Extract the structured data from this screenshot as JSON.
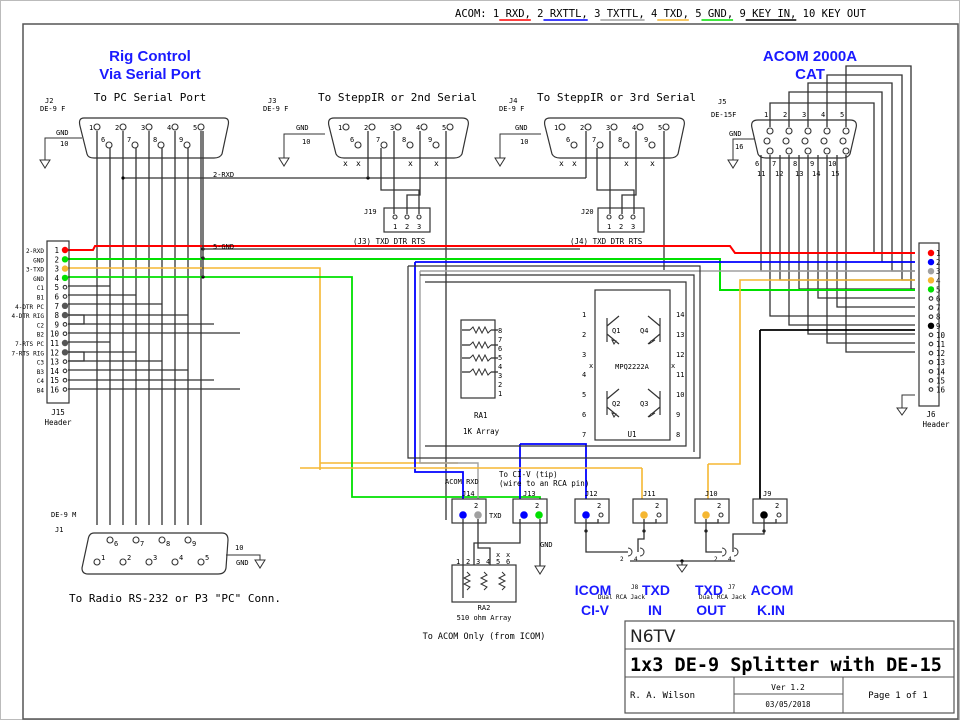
{
  "legend": {
    "prefix": "ACOM:",
    "items": [
      {
        "label": "1 RXD",
        "color": "#ff0000"
      },
      {
        "label": "2 RXTTL",
        "color": "#0000ff"
      },
      {
        "label": "3 TXTTL",
        "color": "#a0a0a0"
      },
      {
        "label": "4 TXD",
        "color": "#f5b732"
      },
      {
        "label": "5 GND",
        "color": "#00e000"
      },
      {
        "label": "9 KEY IN",
        "color": "#000000"
      },
      {
        "label": "10 KEY OUT",
        "color": null
      }
    ]
  },
  "headings": {
    "rig_control_1": "Rig Control",
    "rig_control_2": "Via Serial Port",
    "acom_1": "ACOM 2000A",
    "acom_2": "CAT"
  },
  "connectors": {
    "j2": {
      "ref": "J2",
      "type": "DE-9 F",
      "title": "To PC Serial Port",
      "gnd": "GND",
      "gnd_pin": "10"
    },
    "j3": {
      "ref": "J3",
      "type": "DE-9 F",
      "title": "To SteppIR or 2nd Serial",
      "gnd": "GND",
      "gnd_pin": "10"
    },
    "j4": {
      "ref": "J4",
      "type": "DE-9 F",
      "title": "To SteppIR or 3rd Serial",
      "gnd": "GND",
      "gnd_pin": "10"
    },
    "j5": {
      "ref": "J5",
      "type": "DE-15F",
      "gnd": "GND",
      "gnd_pin": "16",
      "top_pins": [
        "1",
        "2",
        "3",
        "4",
        "5"
      ],
      "bottom_pins": [
        "6",
        "7",
        "8",
        "9",
        "10"
      ],
      "bottom2_pins": [
        "11",
        "12",
        "13",
        "14",
        "15"
      ]
    },
    "j1": {
      "ref": "J1",
      "type": "DE-9 M",
      "title": "To Radio RS-232 or P3 \"PC\" Conn.",
      "gnd": "GND",
      "gnd_pin": "10"
    },
    "de9_top": [
      "1",
      "2",
      "3",
      "4",
      "5"
    ],
    "de9_bottom": [
      "6",
      "7",
      "8",
      "9"
    ]
  },
  "nets": {
    "rxd": "2-RXD",
    "gnd": "5-GND"
  },
  "j19": {
    "ref": "J19",
    "pins": [
      "1",
      "2",
      "3"
    ],
    "caption": "(J3) TXD DTR RTS"
  },
  "j20": {
    "ref": "J20",
    "pins": [
      "1",
      "2",
      "3"
    ],
    "caption": "(J4) TXD DTR RTS"
  },
  "j15": {
    "ref": "J15",
    "sub": "Header",
    "pins": [
      {
        "n": "1",
        "label": "2-RXD",
        "color": "#ff0000"
      },
      {
        "n": "2",
        "label": "GND",
        "color": "#00e000"
      },
      {
        "n": "3",
        "label": "3-TXD",
        "color": "#f5b732"
      },
      {
        "n": "4",
        "label": "GND",
        "color": "#00e000"
      },
      {
        "n": "5",
        "label": "C1",
        "color": null
      },
      {
        "n": "6",
        "label": "B1",
        "color": null
      },
      {
        "n": "7",
        "label": "4-DTR PC",
        "color": "#555555"
      },
      {
        "n": "8",
        "label": "4-DTR RIG",
        "color": "#555555"
      },
      {
        "n": "9",
        "label": "C2",
        "color": null
      },
      {
        "n": "10",
        "label": "B2",
        "color": null
      },
      {
        "n": "11",
        "label": "7-RTS PC",
        "color": "#555555"
      },
      {
        "n": "12",
        "label": "7-RTS RIG",
        "color": "#555555"
      },
      {
        "n": "13",
        "label": "C3",
        "color": null
      },
      {
        "n": "14",
        "label": "B3",
        "color": null
      },
      {
        "n": "15",
        "label": "C4",
        "color": null
      },
      {
        "n": "16",
        "label": "B4",
        "color": null
      }
    ]
  },
  "j6": {
    "ref": "J6",
    "sub": "Header",
    "pins": [
      {
        "n": "1",
        "color": "#ff0000"
      },
      {
        "n": "2",
        "color": "#0000ff"
      },
      {
        "n": "3",
        "color": "#a0a0a0"
      },
      {
        "n": "4",
        "color": "#f5b732"
      },
      {
        "n": "5",
        "color": "#00e000"
      },
      {
        "n": "6",
        "color": null
      },
      {
        "n": "7",
        "color": null
      },
      {
        "n": "8",
        "color": null
      },
      {
        "n": "9",
        "color": "#000000"
      },
      {
        "n": "10",
        "color": null
      },
      {
        "n": "11",
        "color": null
      },
      {
        "n": "12",
        "color": null
      },
      {
        "n": "13",
        "color": null
      },
      {
        "n": "14",
        "color": null
      },
      {
        "n": "15",
        "color": null
      },
      {
        "n": "16",
        "color": null
      }
    ]
  },
  "ra1": {
    "ref": "RA1",
    "desc": "1K Array",
    "pins": [
      "8",
      "7",
      "6",
      "5",
      "4",
      "3",
      "2",
      "1"
    ]
  },
  "u1": {
    "ref": "U1",
    "part": "MPQ2222A",
    "transistors": [
      "Q1",
      "Q4",
      "Q2",
      "Q3"
    ],
    "left_pins": [
      "1",
      "2",
      "3",
      "4",
      "5",
      "6",
      "7"
    ],
    "right_pins": [
      "14",
      "13",
      "12",
      "11",
      "10",
      "9",
      "8"
    ]
  },
  "small_headers": [
    {
      "ref": "J14",
      "p1": "#0000ff",
      "p2": "#a0a0a0",
      "label_top": "ACOM RXD",
      "label_side": "TXD"
    },
    {
      "ref": "J13",
      "p1": "#0000ff",
      "p2": "#00e000",
      "label_top": "",
      "label_side": ""
    },
    {
      "ref": "J12",
      "p1": "#0000ff",
      "p2": null
    },
    {
      "ref": "J11",
      "p1": "#f5b732",
      "p2": null
    },
    {
      "ref": "J10",
      "p1": "#f5b732",
      "p2": null
    },
    {
      "ref": "J9",
      "p1": "#000000",
      "p2": null
    }
  ],
  "civ_note_1": "To CI-V (tip)",
  "civ_note_2": "(wire to an RCA pin)",
  "gnd_label": "GND",
  "ra2": {
    "ref": "RA2",
    "desc": "510 ohm Array",
    "pins": [
      "1",
      "2",
      "3",
      "4",
      "5",
      "6"
    ],
    "note": "To ACOM Only (from ICOM)"
  },
  "rca": {
    "j8": {
      "ref": "J8",
      "desc": "Dual RCA Jack",
      "pin_a": "2",
      "pin_b": "4"
    },
    "j7": {
      "ref": "J7",
      "desc": "Dual RCA Jack",
      "pin_a": "2",
      "pin_b": "4"
    }
  },
  "blue_labels": [
    {
      "l1": "ICOM",
      "l2": "CI-V"
    },
    {
      "l1": "TXD",
      "l2": "IN"
    },
    {
      "l1": "TXD",
      "l2": "OUT"
    },
    {
      "l1": "ACOM",
      "l2": "K.IN"
    }
  ],
  "title_block": {
    "company": "N6TV",
    "title": "1x3 DE-9 Splitter with DE-15",
    "author": "R. A. Wilson",
    "version": "Ver 1.2",
    "date": "03/05/2018",
    "page": "Page 1 of 1"
  }
}
